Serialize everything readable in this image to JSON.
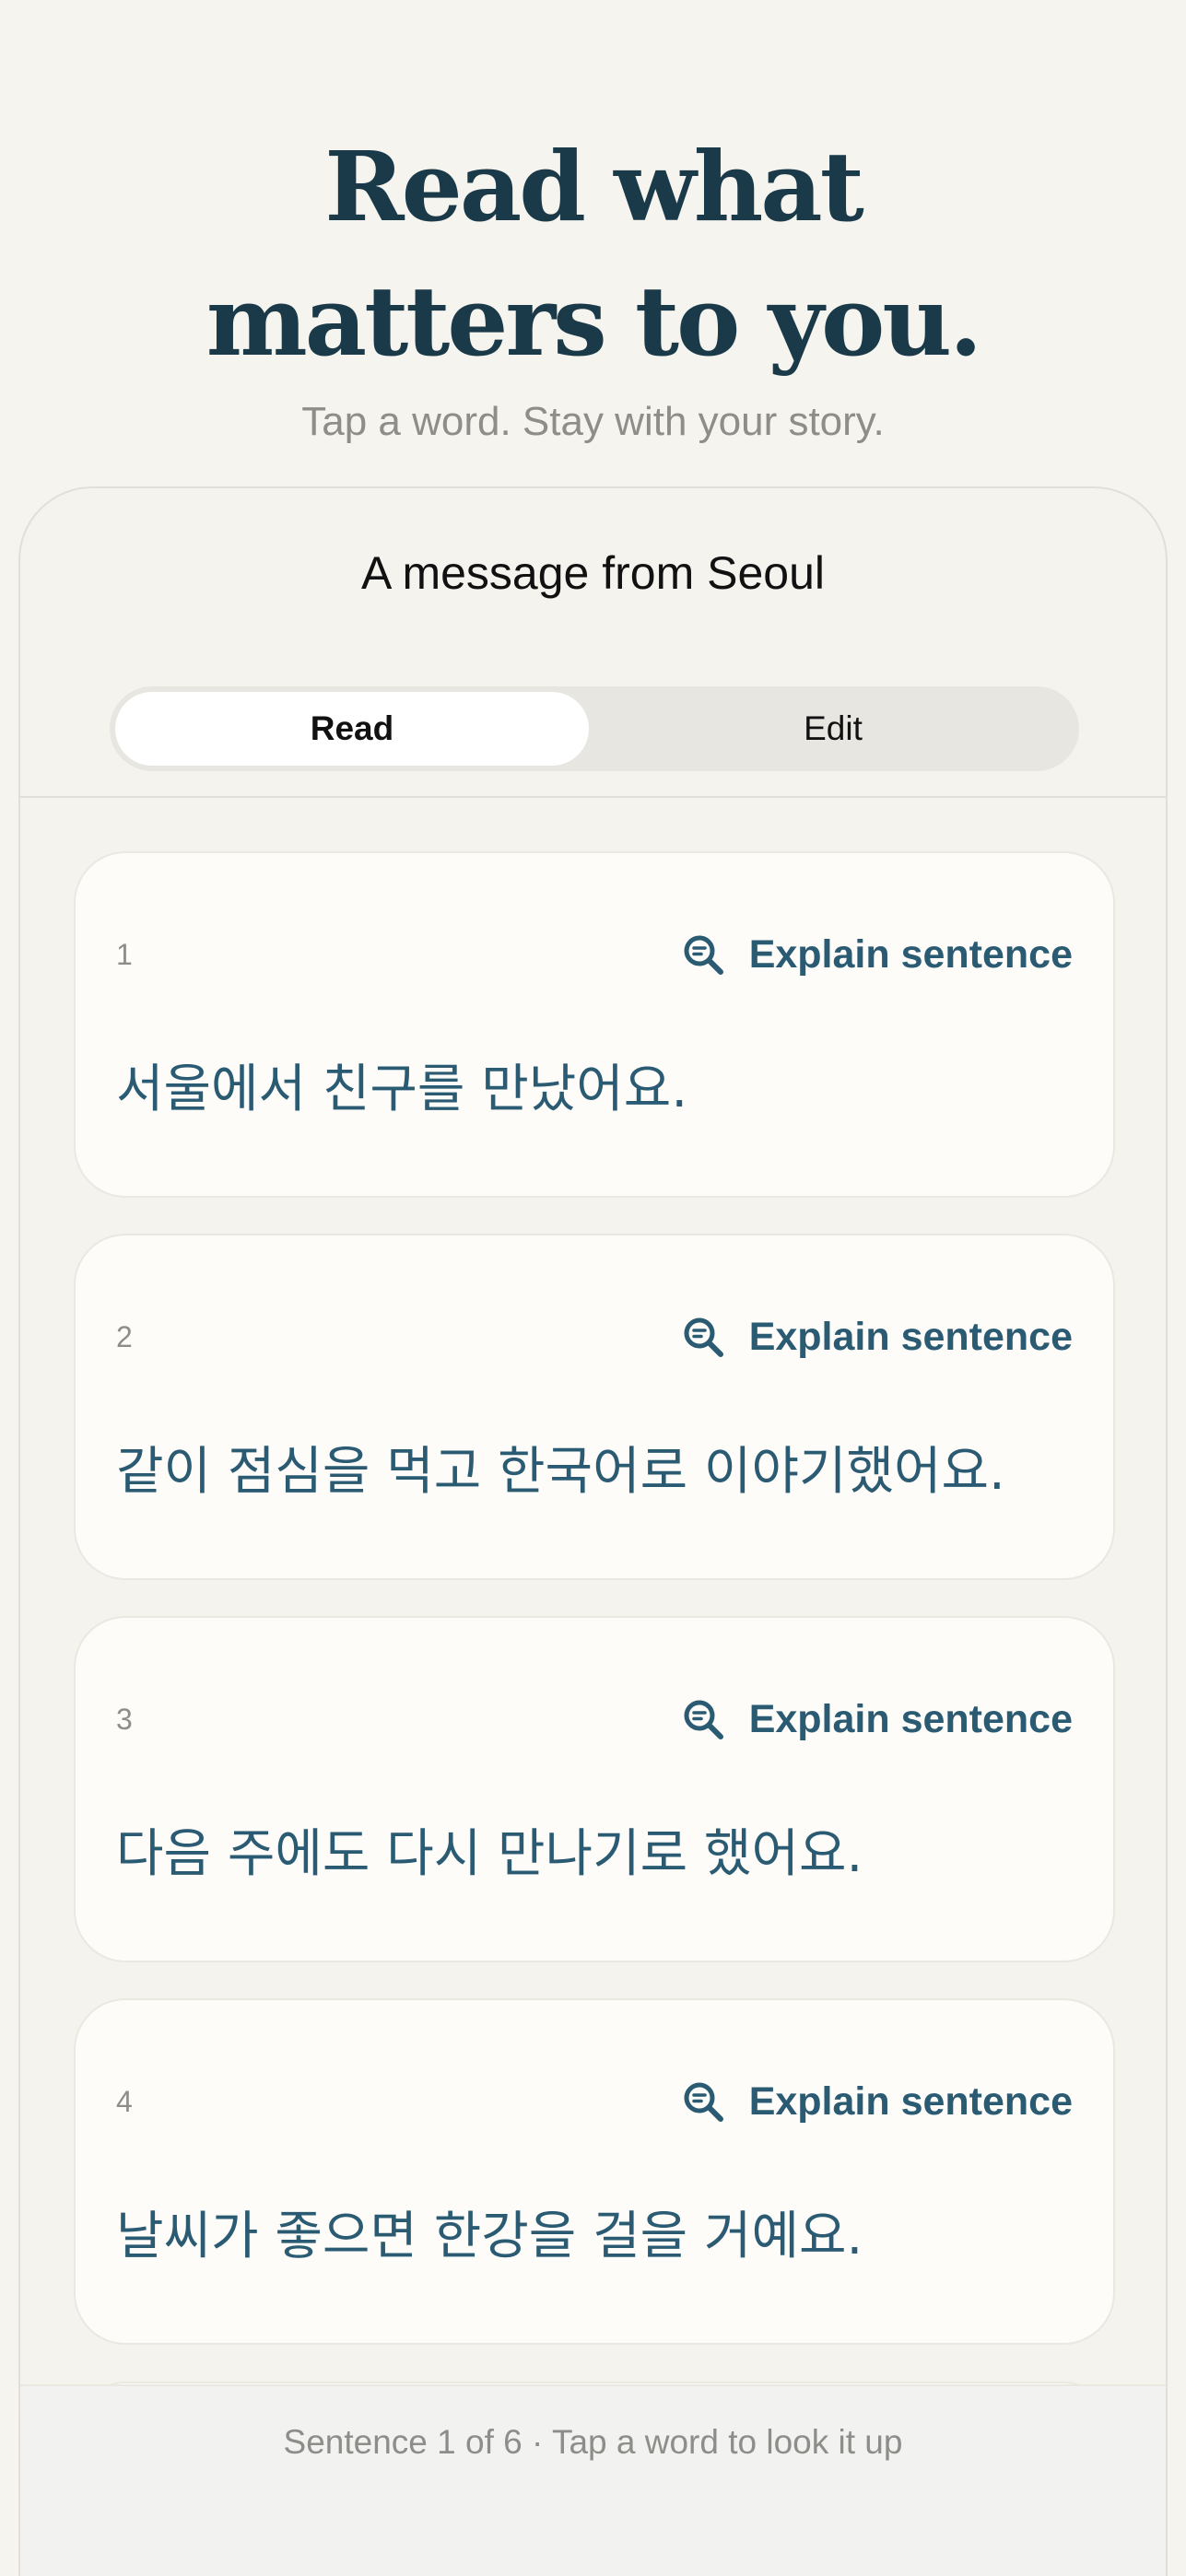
{
  "hero": {
    "title_line1": "Read what",
    "title_line2": "matters to you.",
    "subtitle": "Tap a word. Stay with your story."
  },
  "sheet": {
    "title": "A message from Seoul",
    "tabs": [
      {
        "label": "Read",
        "selected": true
      },
      {
        "label": "Edit",
        "selected": false
      }
    ]
  },
  "explain_label": "Explain sentence",
  "sentences": [
    {
      "num": "1",
      "text": "서울에서 친구를 만났어요."
    },
    {
      "num": "2",
      "text": "같이 점심을 먹고 한국어로 이야기했어요."
    },
    {
      "num": "3",
      "text": "다음 주에도 다시 만나기로 했어요."
    },
    {
      "num": "4",
      "text": "날씨가 좋으면 한강을 걸을 거예요."
    }
  ],
  "footer": {
    "status": "Sentence 1 of 6 · Tap a word to look it up"
  },
  "colors": {
    "accent": "#2b5b73",
    "title": "#1b3a49",
    "muted": "#8d8d89",
    "background": "#f6f4ef"
  }
}
